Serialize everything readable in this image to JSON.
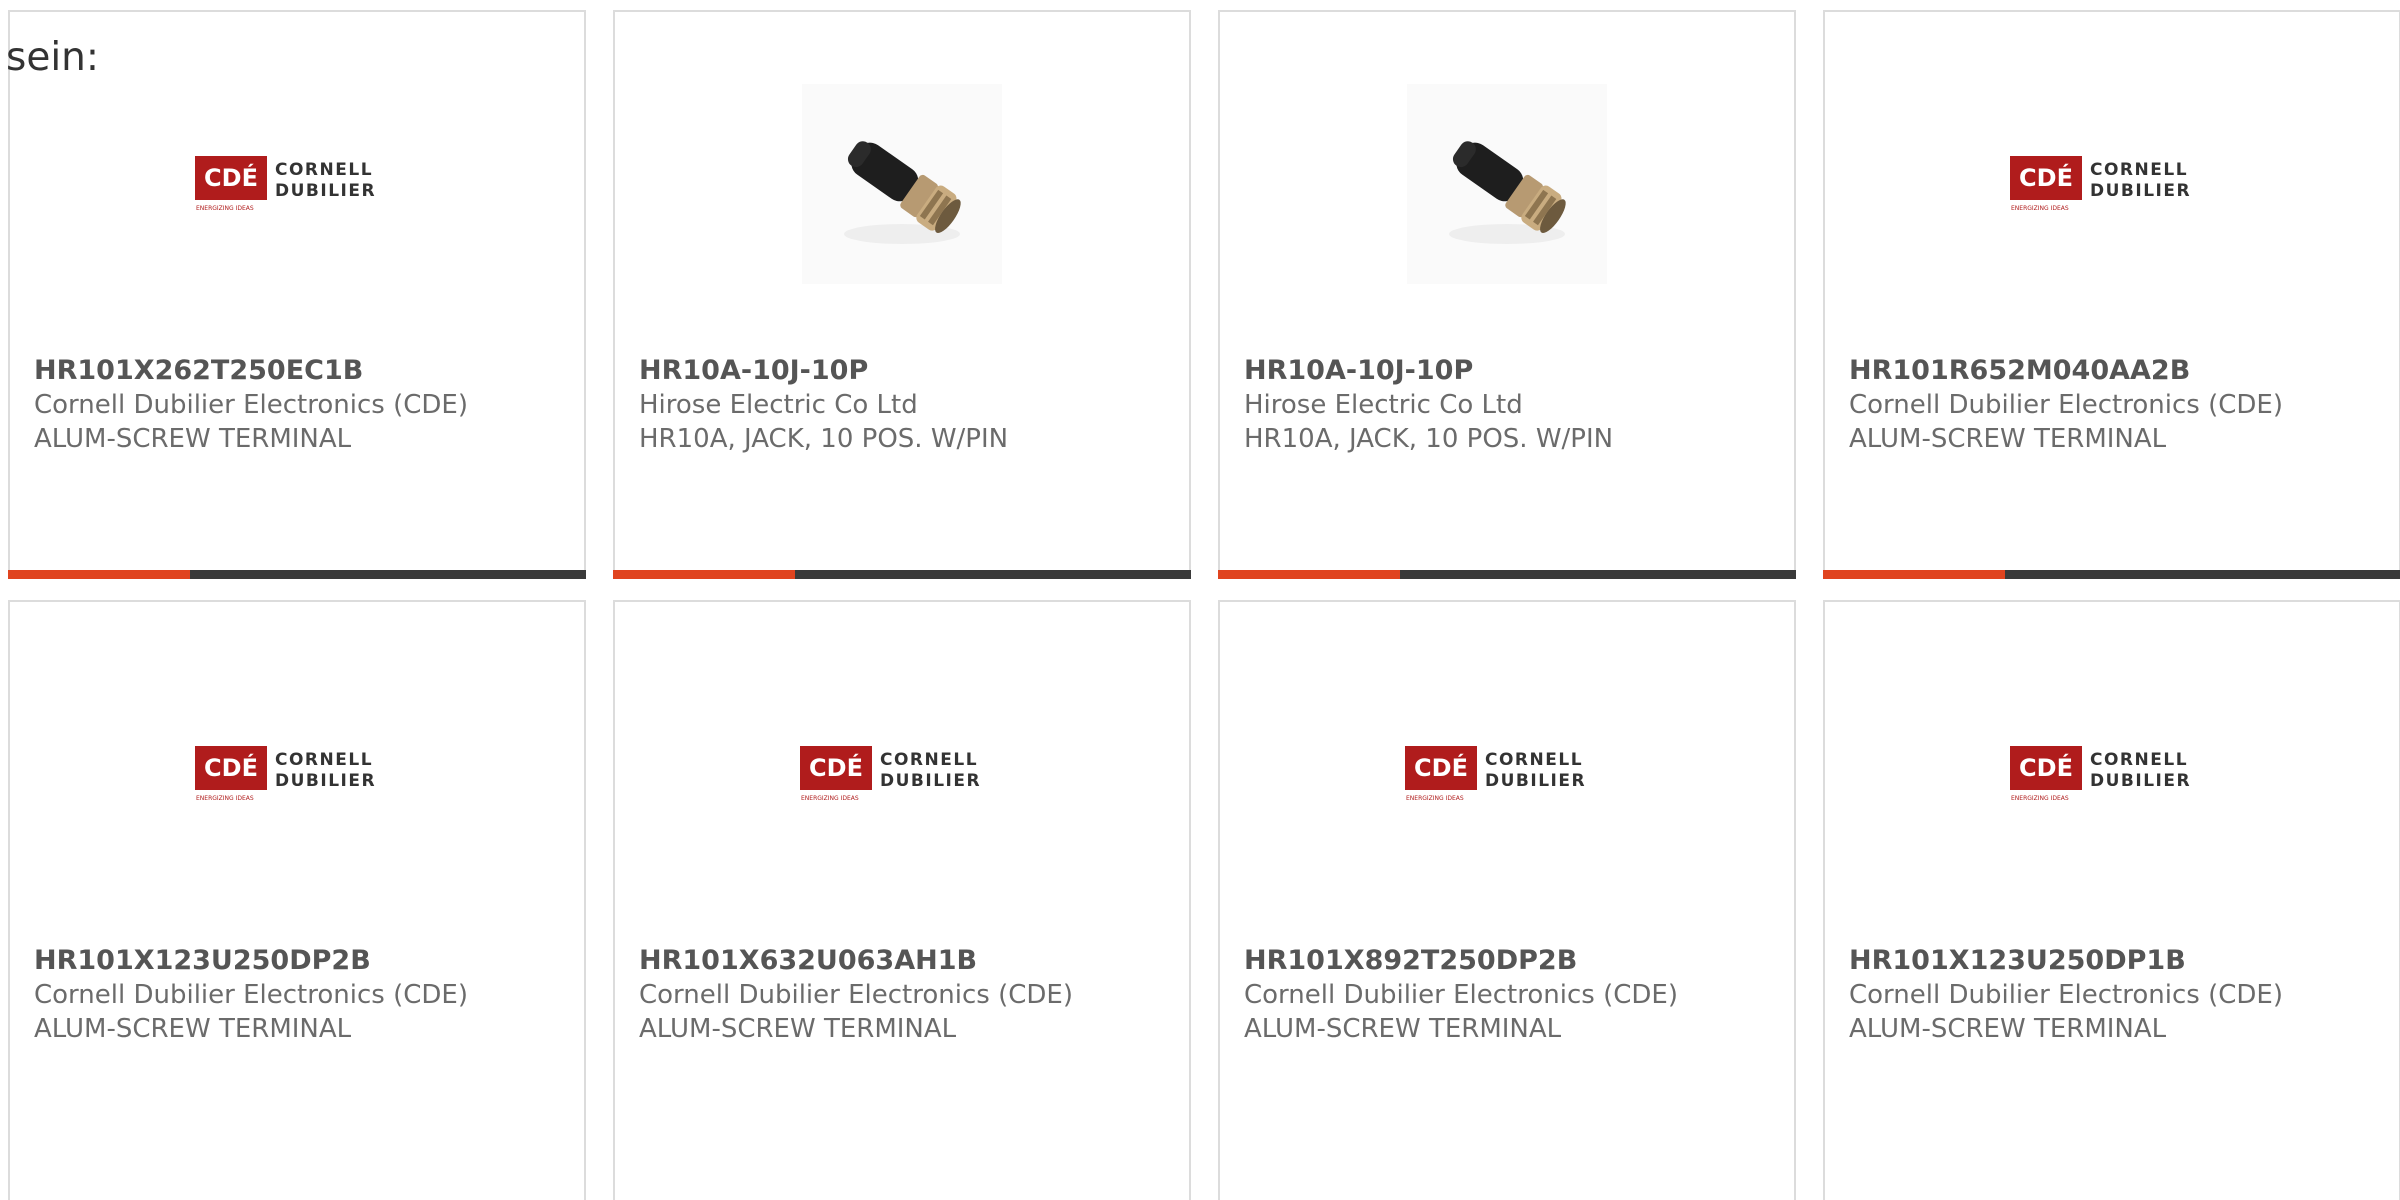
{
  "intro_text": "sein:",
  "brand": {
    "cde_short": "CDÉ",
    "cde_line1": "CORNELL",
    "cde_line2": "DUBILIER",
    "cde_tagline": "ENERGIZING IDEAS",
    "accent_color": "#e0441f",
    "bar_color": "#3a3a3a"
  },
  "products": [
    {
      "part_number": "HR101X262T250EC1B",
      "manufacturer": "Cornell Dubilier Electronics (CDE)",
      "description": "ALUM-SCREW TERMINAL",
      "image": "cde-logo"
    },
    {
      "part_number": "HR10A-10J-10P",
      "manufacturer": "Hirose Electric Co Ltd",
      "description": "HR10A, JACK, 10 POS. W/PIN",
      "image": "connector-photo"
    },
    {
      "part_number": "HR10A-10J-10P",
      "manufacturer": "Hirose Electric Co Ltd",
      "description": "HR10A, JACK, 10 POS. W/PIN",
      "image": "connector-photo"
    },
    {
      "part_number": "HR101R652M040AA2B",
      "manufacturer": "Cornell Dubilier Electronics (CDE)",
      "description": "ALUM-SCREW TERMINAL",
      "image": "cde-logo"
    },
    {
      "part_number": "HR101X123U250DP2B",
      "manufacturer": "Cornell Dubilier Electronics (CDE)",
      "description": "ALUM-SCREW TERMINAL",
      "image": "cde-logo"
    },
    {
      "part_number": "HR101X632U063AH1B",
      "manufacturer": "Cornell Dubilier Electronics (CDE)",
      "description": "ALUM-SCREW TERMINAL",
      "image": "cde-logo"
    },
    {
      "part_number": "HR101X892T250DP2B",
      "manufacturer": "Cornell Dubilier Electronics (CDE)",
      "description": "ALUM-SCREW TERMINAL",
      "image": "cde-logo"
    },
    {
      "part_number": "HR101X123U250DP1B",
      "manufacturer": "Cornell Dubilier Electronics (CDE)",
      "description": "ALUM-SCREW TERMINAL",
      "image": "cde-logo"
    }
  ]
}
